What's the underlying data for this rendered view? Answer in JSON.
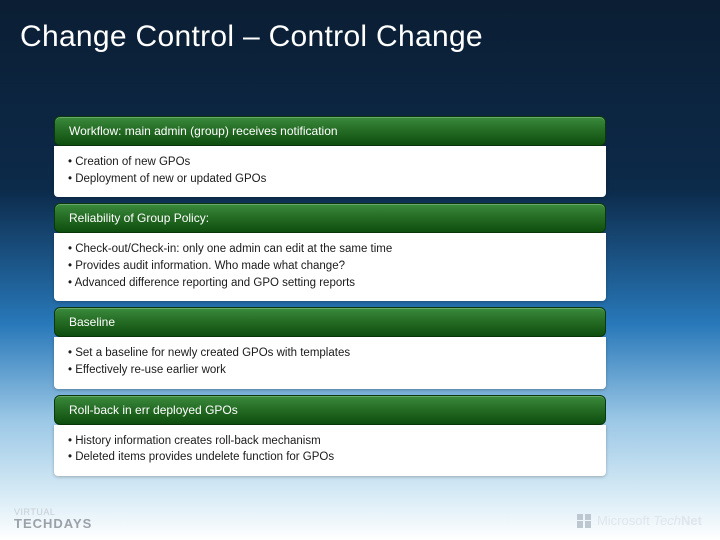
{
  "title": "Change Control – Control Change",
  "sections": [
    {
      "header": "Workflow: main admin (group) receives notification",
      "items": [
        "Creation of new GPOs",
        "Deployment of new or updated GPOs"
      ]
    },
    {
      "header": "Reliability of Group Policy:",
      "items": [
        "Check-out/Check-in: only one admin can edit at the same time",
        "Provides audit information. Who made what change?",
        "Advanced difference reporting and GPO setting reports"
      ]
    },
    {
      "header": "Baseline",
      "items": [
        "Set a baseline for newly created GPOs with templates",
        "Effectively re-use earlier work"
      ]
    },
    {
      "header": "Roll-back in err deployed GPOs",
      "items": [
        "History information creates roll-back mechanism",
        "Deleted items provides undelete function for GPOs"
      ]
    }
  ],
  "footer": {
    "left_line1": "VIRTUAL",
    "left_line2": "TECHDAYS",
    "right_brand": "Microsoft",
    "right_product_prefix": "Tech",
    "right_product_suffix": "Net"
  }
}
